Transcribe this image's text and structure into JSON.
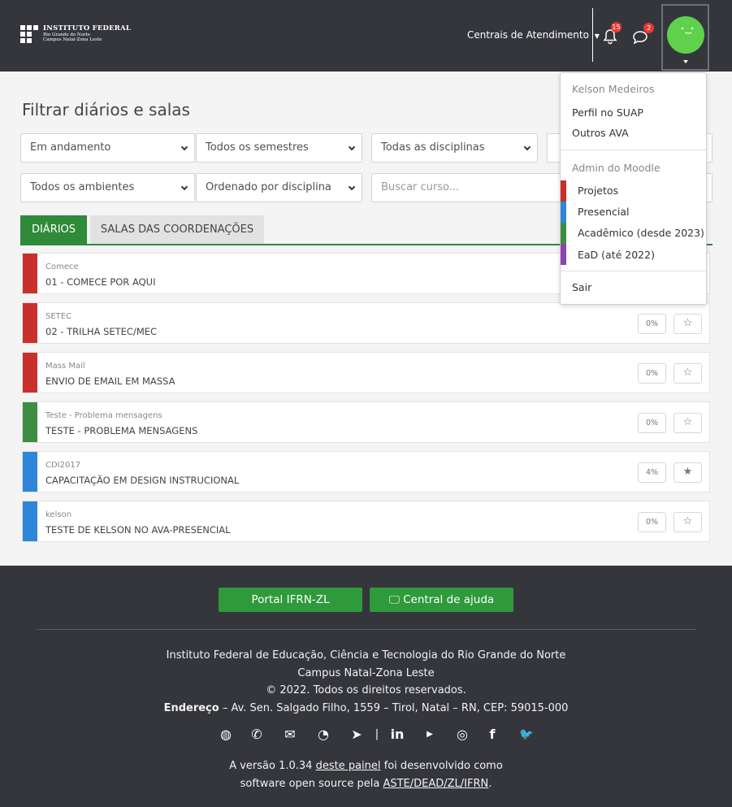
{
  "header": {
    "logo": {
      "line1": "INSTITUTO FEDERAL",
      "line2": "Rio Grande do Norte",
      "line3": "Campus Natal-Zona Leste"
    },
    "centrais_label": "Centrais de Atendimento",
    "notifications_count": "15",
    "messages_count": "2"
  },
  "filters": {
    "title": "Filtrar diários e salas",
    "situacao": "Em andamento",
    "semestre": "Todos os semestres",
    "disciplina": "Todas as disciplinas",
    "ambiente": "Todos os ambientes",
    "ordenacao": "Ordenado por disciplina",
    "search_placeholder": "Buscar curso..."
  },
  "tabs": [
    {
      "label": "DIÁRIOS",
      "active": true
    },
    {
      "label": "SALAS DAS COORDENAÇÕES",
      "active": false
    }
  ],
  "courses": [
    {
      "category": "Comece",
      "name": "01 - COMECE POR AQUI",
      "color": "#c9302c",
      "progress": "",
      "starred": false
    },
    {
      "category": "SETEC",
      "name": "02 - TRILHA SETEC/MEC",
      "color": "#c9302c",
      "progress": "0%",
      "starred": false
    },
    {
      "category": "Mass Mail",
      "name": "ENVIO DE EMAIL EM MASSA",
      "color": "#c9302c",
      "progress": "0%",
      "starred": false
    },
    {
      "category": "Teste - Problema mensagens",
      "name": "TESTE - PROBLEMA MENSAGENS",
      "color": "#3e8e41",
      "progress": "0%",
      "starred": false
    },
    {
      "category": "CDI2017",
      "name": "CAPACITAÇÃO EM DESIGN INSTRUCIONAL",
      "color": "#2f86d8",
      "progress": "4%",
      "starred": true
    },
    {
      "category": "kelson",
      "name": "TESTE DE KELSON NO AVA-PRESENCIAL",
      "color": "#2f86d8",
      "progress": "0%",
      "starred": false
    }
  ],
  "user_menu": {
    "username": "Kelson Medeiros",
    "perfil": "Perfil no SUAP",
    "outros": "Outros AVA",
    "admin": "Admin do Moodle",
    "items": [
      {
        "label": "Projetos",
        "color": "#c9302c"
      },
      {
        "label": "Presencial",
        "color": "#2f86d8"
      },
      {
        "label": "Acadêmico (desde 2023)",
        "color": "#3e8e41"
      },
      {
        "label": "EaD (até 2022)",
        "color": "#8e44ad"
      }
    ],
    "logout": "Sair"
  },
  "footer": {
    "portal_button": "Portal IFRN-ZL",
    "help_button": "Central de ajuda",
    "line1": "Instituto Federal de Educação, Ciência e Tecnologia do Rio Grande do Norte",
    "line2": "Campus Natal-Zona Leste",
    "line3": "© 2022. Todos os direitos reservados.",
    "address_label": "Endereço",
    "address": " – Av. Sen. Salgado Filho, 1559 – Tirol, Natal – RN, CEP: 59015-000",
    "version_prefix": "A versão 1.0.34 ",
    "version_link": "deste painel",
    "version_mid": " foi desenvolvido como",
    "license_prefix": "software open source pela ",
    "license_link": "ASTE/DEAD/ZL/IFRN",
    "license_suffix": ".",
    "social_icons": [
      "globe-icon",
      "phone-icon",
      "mail-icon",
      "whatsapp-icon",
      "telegram-icon",
      "linkedin-icon",
      "youtube-icon",
      "instagram-icon",
      "facebook-icon",
      "twitter-icon"
    ]
  }
}
